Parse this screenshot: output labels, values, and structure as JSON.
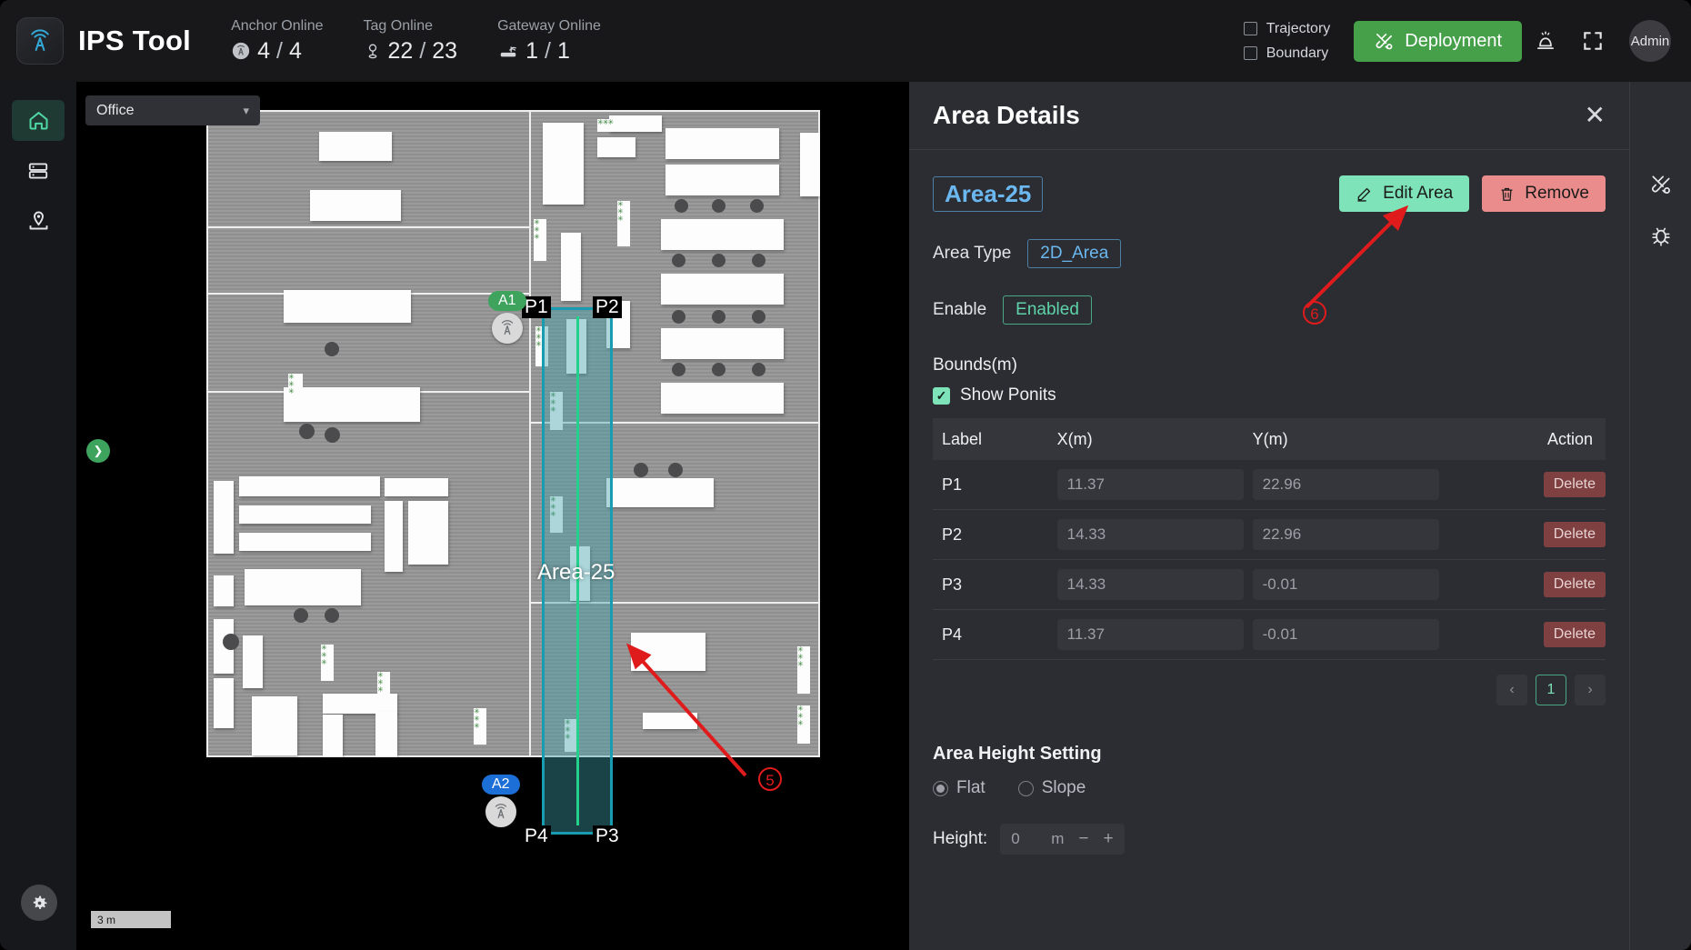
{
  "header": {
    "brand": "IPS Tool",
    "logo_icon": "signal-tower-icon",
    "stats": [
      {
        "label": "Anchor Online",
        "value": "4",
        "total": "4",
        "icon": "anchor-icon"
      },
      {
        "label": "Tag Online",
        "value": "22",
        "total": "23",
        "icon": "tag-pin-icon"
      },
      {
        "label": "Gateway Online",
        "value": "1",
        "total": "1",
        "icon": "gateway-icon"
      }
    ],
    "checkboxes": [
      {
        "label": "Trajectory",
        "checked": false
      },
      {
        "label": "Boundary",
        "checked": false
      }
    ],
    "deploy_label": "Deployment",
    "alarm_icon": "alarm-bell-icon",
    "fullscreen_icon": "fullscreen-icon",
    "avatar_label": "Admin"
  },
  "sidebar": {
    "items": [
      {
        "name": "home",
        "icon": "home-icon",
        "active": true
      },
      {
        "name": "devices",
        "icon": "server-icon",
        "active": false
      },
      {
        "name": "map",
        "icon": "map-pin-icon",
        "active": false
      }
    ],
    "settings_icon": "gear-icon"
  },
  "map": {
    "select_value": "Office",
    "caret_icon": "chevron-down-icon",
    "collapse_icon": "chevron-right-icon",
    "scale_label": "3 m",
    "area_label": "Area-25",
    "point_tags": [
      "P1",
      "P2",
      "P3",
      "P4"
    ],
    "anchors": [
      {
        "label": "A1",
        "color": "#3da35d"
      },
      {
        "label": "A2",
        "color": "#1b6fd6"
      }
    ],
    "annotations": [
      {
        "number": "⑤"
      },
      {
        "number": "⑥"
      }
    ]
  },
  "panel": {
    "title": "Area Details",
    "close_icon": "close-icon",
    "area_name": "Area-25",
    "edit_label": "Edit Area",
    "edit_icon": "pencil-icon",
    "remove_label": "Remove",
    "remove_icon": "trash-icon",
    "area_type_label": "Area Type",
    "area_type_value": "2D_Area",
    "enable_label": "Enable",
    "enable_value": "Enabled",
    "bounds_title": "Bounds(m)",
    "show_points_label": "Show Ponits",
    "show_points_checked": true,
    "check_glyph": "✓",
    "table": {
      "columns": [
        "Label",
        "X(m)",
        "Y(m)",
        "Action"
      ],
      "rows": [
        {
          "label": "P1",
          "x": "11.37",
          "y": "22.96",
          "action": "Delete"
        },
        {
          "label": "P2",
          "x": "14.33",
          "y": "22.96",
          "action": "Delete"
        },
        {
          "label": "P3",
          "x": "14.33",
          "y": "-0.01",
          "action": "Delete"
        },
        {
          "label": "P4",
          "x": "11.37",
          "y": "-0.01",
          "action": "Delete"
        }
      ]
    },
    "pager": {
      "prev": "‹",
      "current": "1",
      "next": "›"
    },
    "height_setting_title": "Area Height Setting",
    "radio_flat": "Flat",
    "radio_slope": "Slope",
    "radio_selected": "Flat",
    "height_label": "Height:",
    "height_value": "0",
    "height_unit": "m",
    "minus": "−",
    "plus": "+"
  },
  "toolrail": {
    "items": [
      {
        "name": "tools",
        "icon": "tools-icon"
      },
      {
        "name": "debug",
        "icon": "bug-icon"
      }
    ]
  },
  "colors": {
    "accent_green": "#45a049",
    "mint": "#7ee3b8",
    "danger": "#eb8c8c",
    "area_fill": "#3ca0aa",
    "area_stroke": "#1a9cb0",
    "anno_red": "#e01b1b"
  }
}
